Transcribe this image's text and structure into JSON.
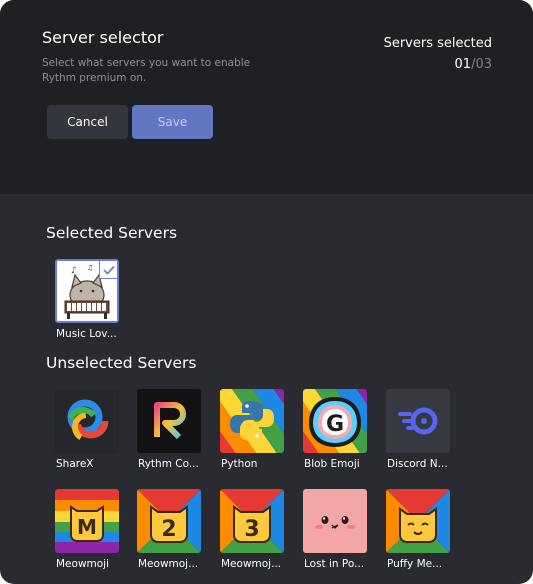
{
  "header": {
    "title": "Server selector",
    "description": "Select what servers you want to enable Rythm premium on.",
    "count_label": "Servers selected",
    "count_current": "01",
    "count_separator": "/",
    "count_total": "03"
  },
  "buttons": {
    "cancel": "Cancel",
    "save": "Save"
  },
  "selected": {
    "title": "Selected Servers",
    "servers": [
      {
        "name": "Music Lov...",
        "icon": "pusheen-piano-icon"
      }
    ]
  },
  "unselected": {
    "title": "Unselected Servers",
    "servers": [
      {
        "name": "ShareX",
        "icon": "sharex-icon"
      },
      {
        "name": "Rythm Co...",
        "icon": "rythm-logo-icon"
      },
      {
        "name": "Python",
        "icon": "python-logo-icon"
      },
      {
        "name": "Blob Emoji",
        "icon": "blob-g-icon"
      },
      {
        "name": "Discord N...",
        "icon": "discord-nitro-icon"
      },
      {
        "name": "Meowmoji",
        "icon": "meowmoji-m-icon"
      },
      {
        "name": "Meowmoj...",
        "icon": "meowmoji-2-icon"
      },
      {
        "name": "Meowmoj...",
        "icon": "meowmoji-3-icon"
      },
      {
        "name": "Lost in Po...",
        "icon": "pink-face-icon"
      },
      {
        "name": "Puffy Me...",
        "icon": "puffy-cat-icon"
      }
    ]
  },
  "colors": {
    "accent": "#6277c2",
    "background": "#2a2b30",
    "header": "#1f2024",
    "muted": "#8e9097"
  }
}
